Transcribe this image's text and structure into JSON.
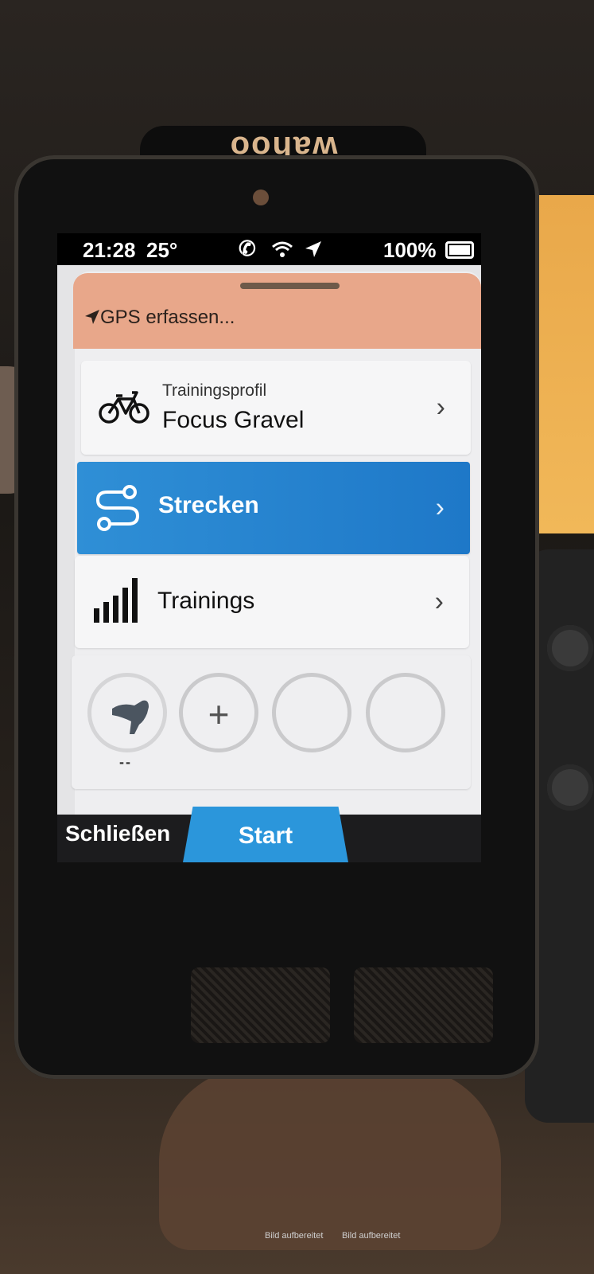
{
  "device": {
    "brand": "wahoo"
  },
  "status_bar": {
    "time": "21:28",
    "temperature": "25°",
    "battery": "100%"
  },
  "gps_banner": {
    "text": "GPS erfassen..."
  },
  "menu": {
    "profile": {
      "label": "Trainingsprofil",
      "value": "Focus Gravel"
    },
    "routes": {
      "label": "Strecken"
    },
    "trainings": {
      "label": "Trainings"
    }
  },
  "sensors": {
    "first_value": "--",
    "add_symbol": "+"
  },
  "footer": {
    "close_label": "Schließen",
    "start_label": "Start"
  },
  "watermarks": [
    "Bild aufbereitet",
    "Bild aufbereitet"
  ]
}
